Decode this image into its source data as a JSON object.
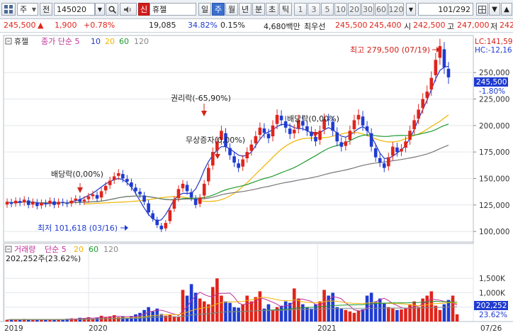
{
  "toolbar": {
    "market_icon": "grid-icon",
    "market_label": "주",
    "prev_label": "전",
    "code": "145020",
    "new_badge": "신",
    "stock_name": "휴젤",
    "periods": [
      "일",
      "주",
      "월",
      "년",
      "분",
      "초",
      "틱"
    ],
    "active_period": "주",
    "intervals": [
      "1",
      "3",
      "5",
      "10",
      "20",
      "30",
      "60",
      "120"
    ],
    "page_counter": "101",
    "page_total": "/292"
  },
  "quote": {
    "price": "245,500",
    "change_arrow": "▲",
    "change": "1,900",
    "change_pct": "+0.78%",
    "volume": "19,085",
    "turnover_pct": "34.82%",
    "ratio": "0.15%",
    "amount": "4,680백만",
    "priority_ask_label": "최우선",
    "ask": "245,500",
    "bid": "245,400",
    "open_label": "시",
    "open": "242,500",
    "high_label": "고",
    "high": "247,000",
    "low_label": "저",
    "low": "242"
  },
  "colors": {
    "up": "#e0241b",
    "down": "#1f3bd1",
    "ma5": "#2135c8",
    "ma10": "#1f3bd1",
    "ma20": "#f0b400",
    "ma60": "#1f9a2e",
    "ma120": "#777777"
  },
  "chart_data": [
    {
      "type": "line",
      "title": "휴젤",
      "legend": [
        {
          "name": "종가 단순 5",
          "color": "#c0309a"
        },
        {
          "name": "10",
          "color": "#2135c8"
        },
        {
          "name": "20",
          "color": "#f0b400"
        },
        {
          "name": "60",
          "color": "#1f9a2e"
        },
        {
          "name": "120",
          "color": "#888888"
        }
      ],
      "x_labels": [
        "2019",
        "2020",
        "2021",
        "07/26"
      ],
      "y_ticks": [
        "100,000",
        "125,000",
        "150,000",
        "175,000",
        "200,000",
        "225,000",
        "250,000"
      ],
      "ylim": [
        90000,
        285000
      ],
      "right_badges": {
        "lc": "LC:141,59",
        "hc": "HC:-12,16",
        "current": "245,500",
        "current_pct": "-1.80%"
      },
      "annotations": {
        "high": "최고 279,500 (07/19)",
        "low": "최저 101,618 (03/16)",
        "rights": "권리락(-65,90%)",
        "bonus": "무상증자(0,00%)",
        "dividend_1": "배당락(0,00%)",
        "dividend_2": "배당락(0,00%)"
      },
      "candles_close": [
        128000,
        126000,
        129000,
        127000,
        130000,
        125000,
        128000,
        124000,
        127000,
        126000,
        129000,
        125000,
        128000,
        127000,
        126000,
        129000,
        131000,
        128000,
        130000,
        133000,
        135000,
        131000,
        138000,
        143000,
        148000,
        152000,
        155000,
        150000,
        147000,
        142000,
        138000,
        135000,
        128000,
        118000,
        112000,
        106000,
        102000,
        108000,
        120000,
        130000,
        140000,
        145000,
        138000,
        132000,
        125000,
        132000,
        145000,
        160000,
        175000,
        185000,
        195000,
        180000,
        172000,
        165000,
        160000,
        168000,
        175000,
        182000,
        190000,
        198000,
        193000,
        188000,
        200000,
        210000,
        205000,
        198000,
        192000,
        196000,
        205000,
        200000,
        195000,
        190000,
        185000,
        195000,
        206000,
        205000,
        195000,
        185000,
        180000,
        185000,
        195000,
        205000,
        210000,
        200000,
        195000,
        180000,
        170000,
        165000,
        160000,
        170000,
        180000,
        175000,
        178000,
        185000,
        195000,
        205000,
        215000,
        225000,
        232000,
        245000,
        262000,
        275000,
        255000,
        245500
      ],
      "ma5": [
        127000,
        127500,
        128000,
        127500,
        128000,
        127000,
        126500,
        126000,
        126500,
        126500,
        127000,
        127500,
        127000,
        128000,
        129000,
        130000,
        132000,
        134000,
        136000,
        139000,
        142000,
        145000,
        147000,
        149000,
        150000,
        149000,
        146000,
        142000,
        136000,
        129000,
        122000,
        116000,
        112000,
        110000,
        111000,
        116000,
        123000,
        130000,
        134000,
        136000,
        136000,
        136000,
        140000,
        148000,
        158000,
        166000,
        172000,
        177000,
        180000,
        180000,
        178000,
        175000,
        172000,
        171000,
        172000,
        175000,
        181000,
        187000,
        192000,
        194000,
        196000,
        199000,
        201000,
        201000,
        200000,
        198000,
        197000,
        197000,
        195000,
        193000,
        192000,
        193000,
        196000,
        198000,
        196000,
        193000,
        190000,
        189000,
        191000,
        194000,
        197000,
        199000,
        196000,
        190000,
        182000,
        174000,
        169000,
        169000,
        171000,
        174000,
        177000,
        181000,
        188000,
        196000,
        206000,
        215000,
        224000,
        234000,
        244000,
        252000,
        255000,
        256000
      ],
      "ma20": [
        126000,
        126200,
        126400,
        126600,
        126800,
        127000,
        127200,
        127400,
        127600,
        127800,
        128000,
        128300,
        128600,
        129000,
        129500,
        130000,
        130600,
        131200,
        131800,
        132300,
        132700,
        132900,
        132800,
        132400,
        131800,
        131000,
        130000,
        129000,
        128500,
        128300,
        128500,
        129000,
        130000,
        131500,
        133500,
        136000,
        139000,
        142500,
        146000,
        150000,
        154000,
        158000,
        162000,
        166000,
        170000,
        174000,
        177500,
        180500,
        183000,
        185000,
        186500,
        187500,
        188000,
        188200,
        188300,
        188400,
        188600,
        189000,
        190000,
        191000,
        192000,
        193000,
        193500,
        193500,
        193000,
        192000,
        190500,
        189000,
        187500,
        186000,
        185000,
        184500,
        184500,
        185000,
        186000,
        187500,
        189000,
        190500,
        192000,
        194000,
        196500,
        199000,
        201500,
        204000,
        207000,
        210000
      ],
      "volume_legend": [
        {
          "name": "거래량",
          "color": "#c0309a"
        },
        {
          "name": "단순 5",
          "color": "#c0309a"
        },
        {
          "name": "20",
          "color": "#f0b400"
        },
        {
          "name": "60",
          "color": "#1f9a2e"
        },
        {
          "name": "120",
          "color": "#888888"
        }
      ],
      "volume_last": "202,252주(23.62%)",
      "volume_y_ticks": [
        "1,500K",
        "1,000K",
        "500K"
      ],
      "volume_badges": {
        "value": "202,252",
        "pct": "23.62%"
      },
      "volumes": [
        60,
        80,
        70,
        55,
        90,
        60,
        50,
        70,
        65,
        80,
        75,
        60,
        85,
        70,
        95,
        110,
        90,
        130,
        120,
        150,
        100,
        140,
        200,
        160,
        180,
        220,
        150,
        170,
        130,
        190,
        250,
        300,
        400,
        500,
        350,
        450,
        260,
        200,
        230,
        180,
        150,
        1100,
        900,
        1300,
        1000,
        800,
        700,
        600,
        1200,
        1500,
        900,
        700,
        650,
        500,
        480,
        600,
        900,
        700,
        850,
        1050,
        450,
        600,
        400,
        500,
        550,
        700,
        650,
        1150,
        800,
        600,
        500,
        450,
        600,
        700,
        1100,
        900,
        1000,
        500,
        450,
        400,
        350,
        300,
        380,
        420,
        900,
        1000,
        700,
        800,
        650,
        500,
        450,
        400,
        420,
        450,
        600,
        700,
        500,
        800,
        900,
        1050,
        550,
        400,
        600,
        750,
        900,
        250
      ]
    }
  ]
}
